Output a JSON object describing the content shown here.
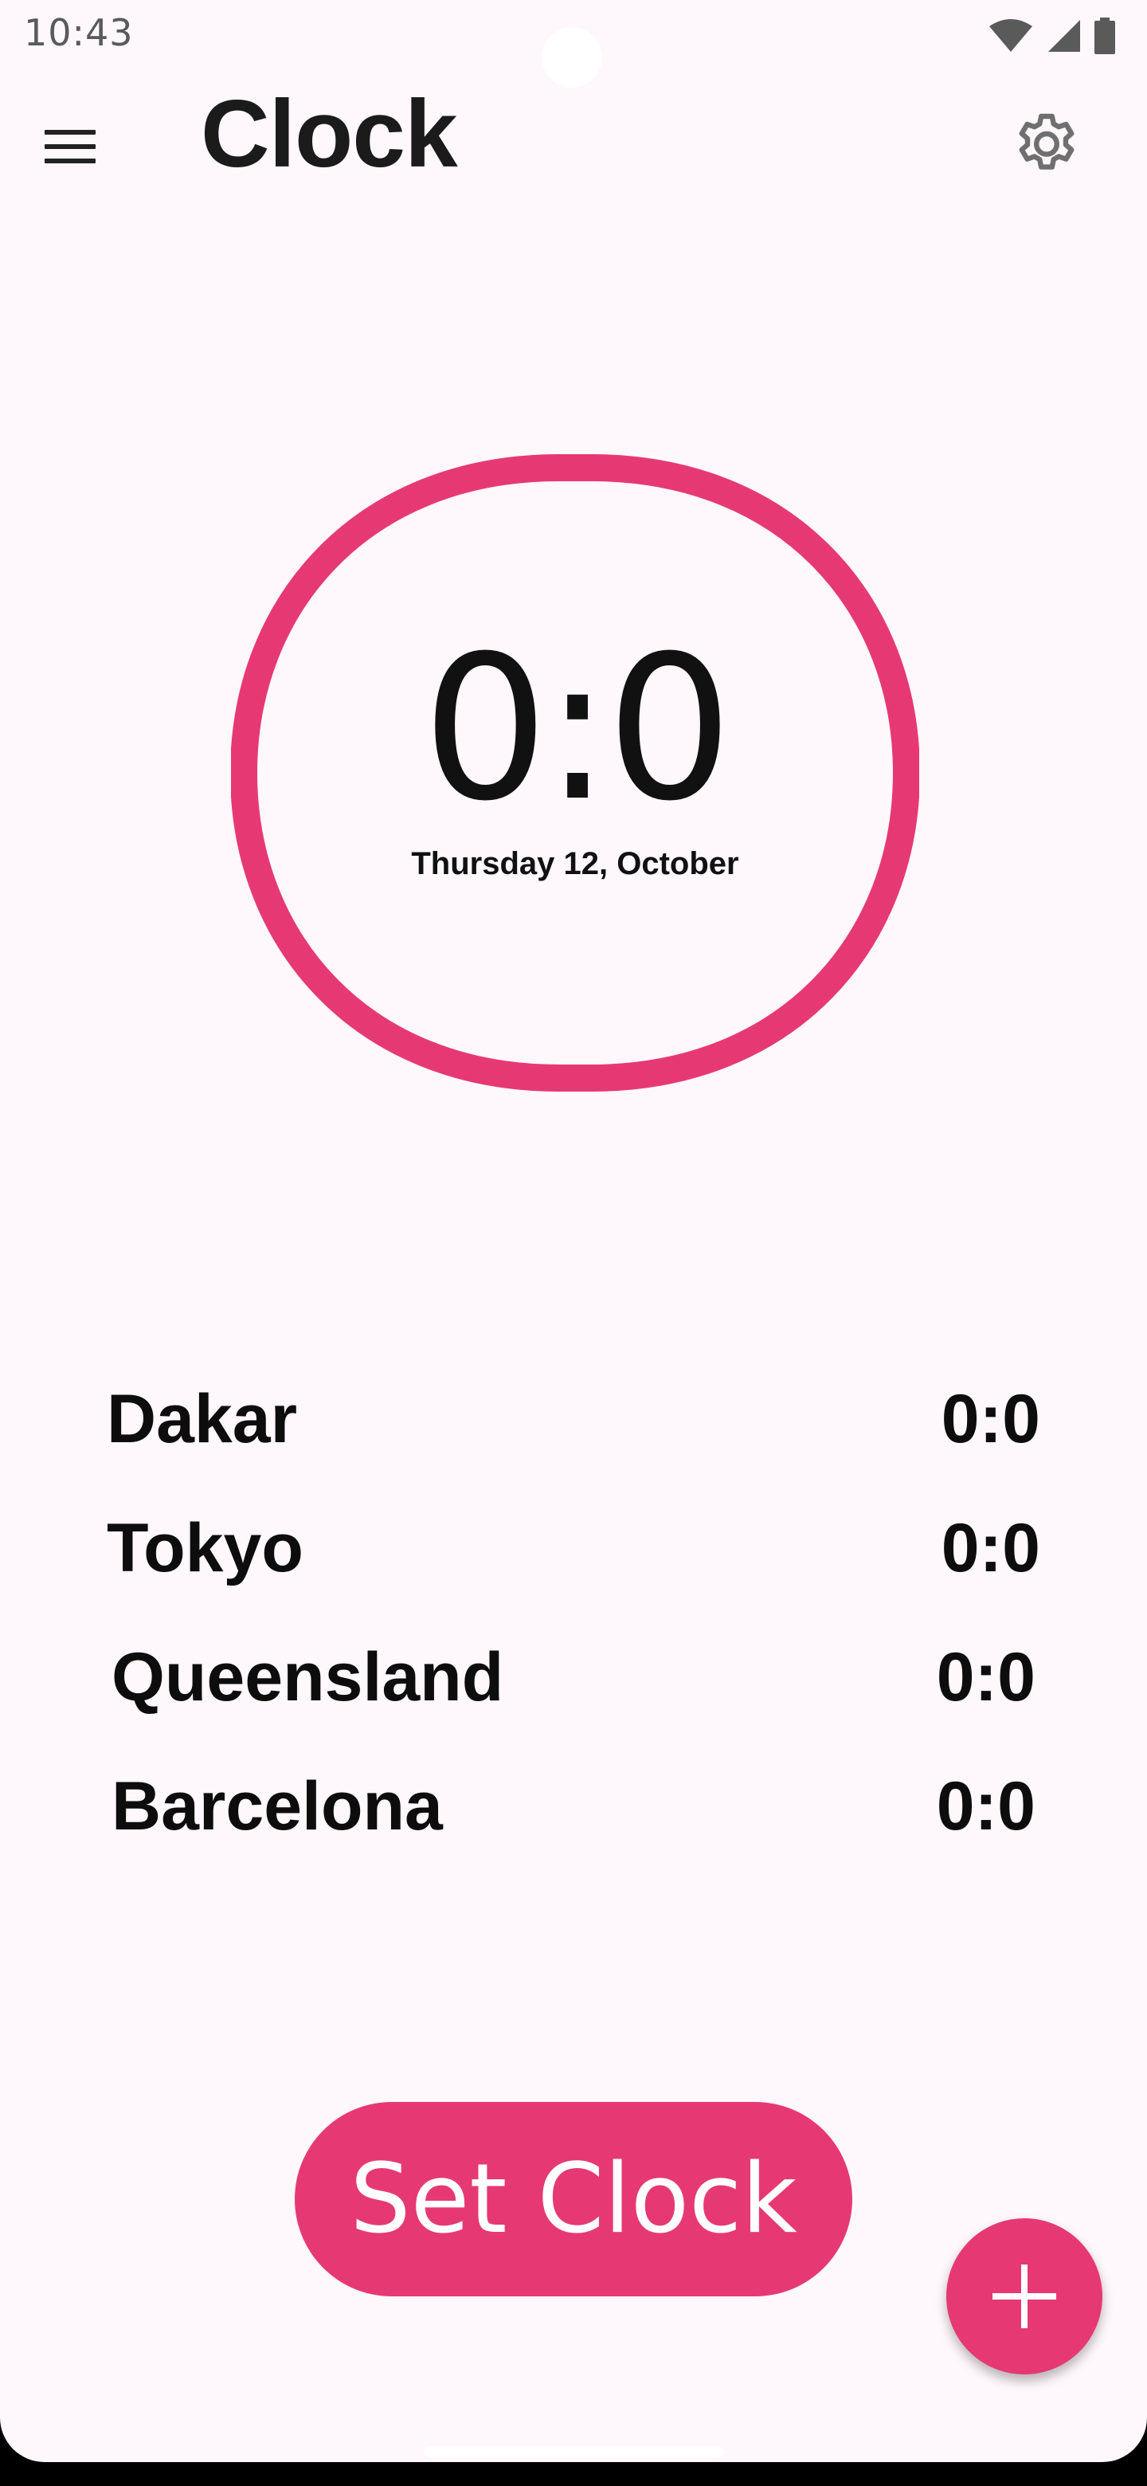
{
  "status_bar": {
    "time": "10:43",
    "icons": [
      "wifi-icon",
      "signal-icon",
      "battery-icon"
    ]
  },
  "app_bar": {
    "title": "Clock",
    "menu_icon": "menu-icon",
    "settings_icon": "gear-icon"
  },
  "main_clock": {
    "time": "0:0",
    "date": "Thursday 12, October",
    "ring_color": "#e63974"
  },
  "world_clocks": [
    {
      "city": "Dakar",
      "time": "0:0"
    },
    {
      "city": "Tokyo",
      "time": "0:0"
    },
    {
      "city": "Queensland",
      "time": "0:0"
    },
    {
      "city": "Barcelona",
      "time": "0:0"
    }
  ],
  "actions": {
    "set_clock_label": "Set Clock",
    "fab_icon": "plus-icon",
    "accent_color": "#e63974"
  }
}
